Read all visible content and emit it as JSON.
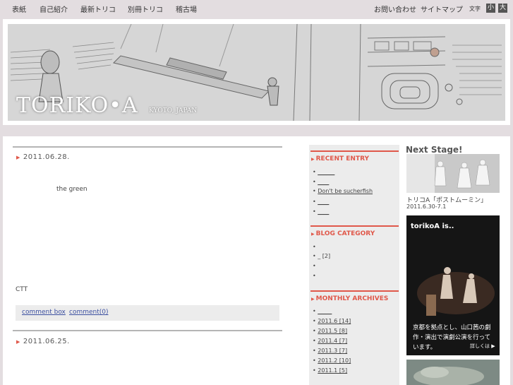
{
  "nav": {
    "items": [
      "表紙",
      "自己紹介",
      "最新トリコ",
      "別冊トリコ",
      "稽古場"
    ],
    "right": [
      "お問い合わせ",
      "サイトマップ"
    ],
    "text_size_label": "文字",
    "size_small": "小",
    "size_large": "大"
  },
  "header": {
    "logo": "TORIKO•A",
    "location": "KYOTO, JAPAN"
  },
  "posts": [
    {
      "date": "2011.06.28.",
      "body_line1": "the green",
      "body_line2": "CTT",
      "comment_box": "comment box",
      "comment_count": "comment(0)"
    },
    {
      "date": "2011.06.25."
    }
  ],
  "sidebar": {
    "recent_entry": {
      "title": "RECENT ENTRY",
      "items": [
        "______",
        "____",
        "Don't be sucherfish",
        "____",
        "____"
      ]
    },
    "blog_category": {
      "title": "BLOG CATEGORY",
      "items": [
        "",
        "_ [2]",
        "",
        ""
      ]
    },
    "monthly_archives": {
      "title": "MONTHLY ARCHIVES",
      "items": [
        "_____",
        "2011.6 [14]",
        "2011.5 [8]",
        "2011.4 [7]",
        "2011.3 [7]",
        "2011.2 [10]",
        "2011.1 [5]"
      ]
    }
  },
  "right": {
    "next_stage": "Next Stage!",
    "show_title": "トリコA「ポストムーミン」",
    "show_date": "2011.6.30-7.1",
    "promo_title": "torikoA is..",
    "promo_text": "京都を拠点とし、山口茜の劇作・演出で演劇公演を行っています。",
    "promo_more": "詳しくは ▶"
  },
  "colors": {
    "accent": "#e0584a",
    "link": "#3b4fa0",
    "background": "#e3dde0"
  }
}
